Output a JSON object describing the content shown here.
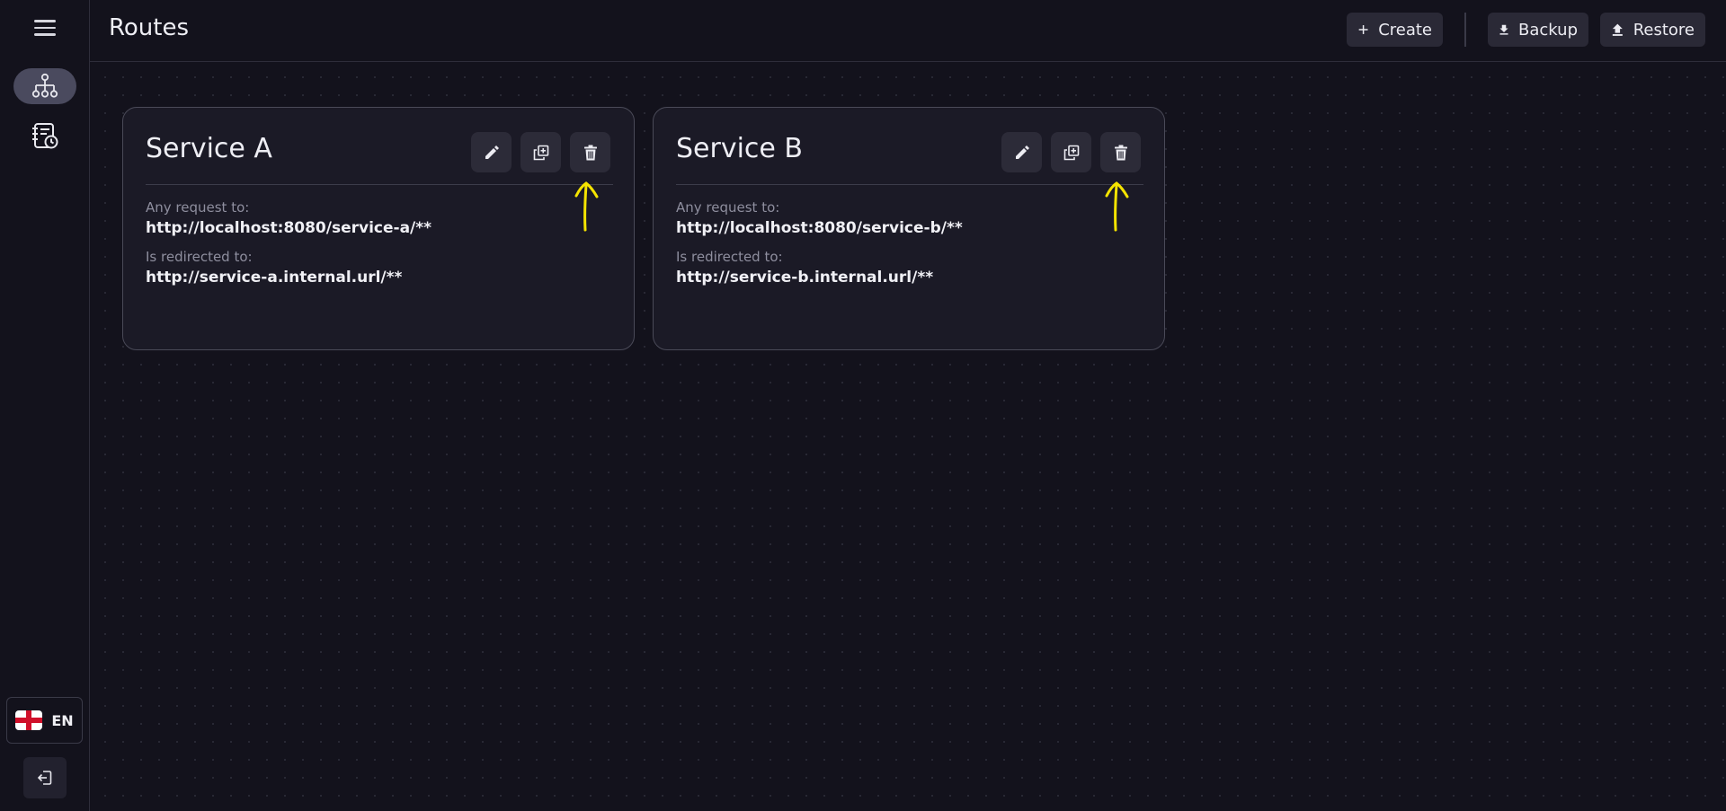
{
  "sidebar": {
    "menu_icon": "hamburger-menu-icon",
    "nav_items": [
      {
        "name": "routes",
        "icon": "sitemap-icon",
        "active": true
      },
      {
        "name": "logs",
        "icon": "log-history-icon",
        "active": false
      }
    ],
    "language": {
      "label": "EN",
      "flag_icon": "england-flag-icon"
    },
    "logout_icon": "logout-icon"
  },
  "header": {
    "title": "Routes",
    "create_label": "Create",
    "backup_label": "Backup",
    "restore_label": "Restore"
  },
  "cards": [
    {
      "title": "Service A",
      "request_label": "Any request to:",
      "request_url": "http://localhost:8080/service-a/**",
      "redirect_label": "Is redirected to:",
      "redirect_url": "http://service-a.internal.url/**"
    },
    {
      "title": "Service B",
      "request_label": "Any request to:",
      "request_url": "http://localhost:8080/service-b/**",
      "redirect_label": "Is redirected to:",
      "redirect_url": "http://service-b.internal.url/**"
    }
  ],
  "colors": {
    "background": "#13121c",
    "card": "#1b1a26",
    "accent_annotation": "#f5e400",
    "active_nav": "#4a4a5e"
  }
}
